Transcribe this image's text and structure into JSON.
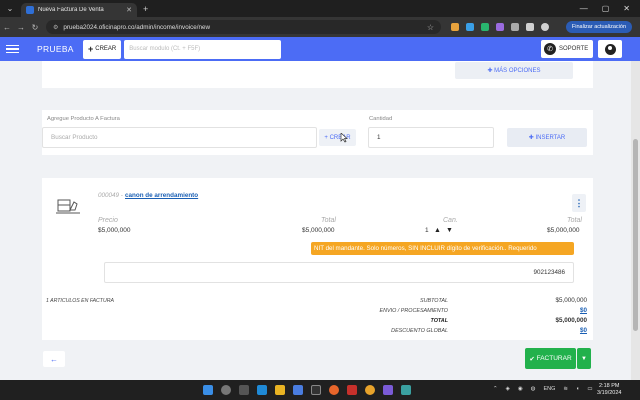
{
  "browser": {
    "tab_title": "Nueva Factura De Venta",
    "url": "prueba2024.oficinapro.co/admin/income/invoice/new",
    "update_label": "Finalizar actualización"
  },
  "header": {
    "brand": "PRUEBA",
    "create_label": "CREAR",
    "search_placeholder": "Buscar modulo (Ct. + F5F)",
    "support_label": "SOPORTE"
  },
  "top": {
    "more_options_label": "MÁS OPCIONES"
  },
  "add_product": {
    "label": "Agregue Producto A Factura",
    "product_placeholder": "Buscar Producto",
    "create_label": "+ CREAR",
    "qty_label": "Cantidad",
    "qty_value": "1",
    "insert_label": "INSERTAR"
  },
  "item": {
    "code": "000049 -",
    "name": "canon de arrendamiento",
    "price_label": "Precio",
    "price_value": "$5,000,000",
    "total_label": "Total",
    "total_value": "$5,000,000",
    "qty_label": "Can.",
    "qty_value": "1",
    "total2_label": "Total",
    "total2_value": "$5,000,000",
    "nit_warning": "NIT del mandante. Solo números, SIN INCLUIR dígito de verificación.. Requerido",
    "nit_value": "902123486"
  },
  "summary": {
    "articles": "1 ARTICULOS EN FACTURA",
    "subtotal_label": "SUBTOTAL",
    "subtotal_value": "$5,000,000",
    "shipping_label": "ENVIO / PROCESAMIENTO",
    "shipping_value": "$0",
    "total_label": "TOTAL",
    "total_value": "$5,000,000",
    "discount_label": "DESCUENTO GLOBAL",
    "discount_value": "$0"
  },
  "footer": {
    "invoice_label": "FACTURAR"
  },
  "taskbar": {
    "lang": "ENG",
    "time": "2:18 PM",
    "date": "3/19/2024"
  }
}
